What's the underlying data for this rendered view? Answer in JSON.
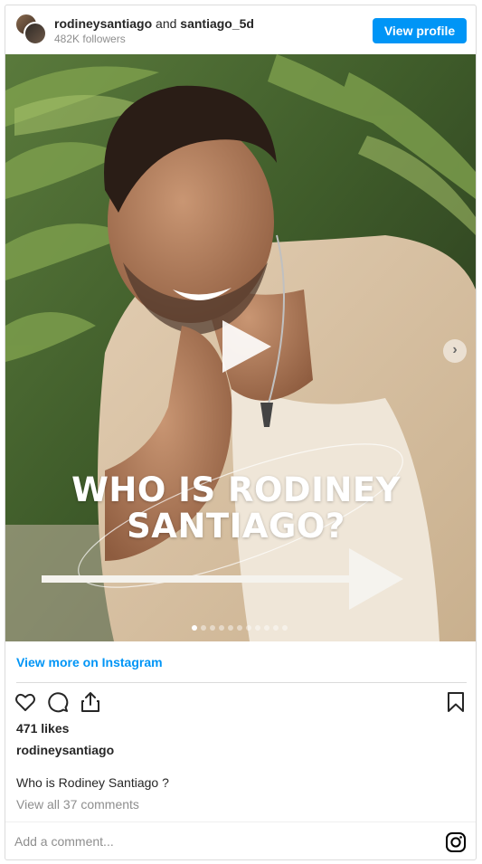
{
  "header": {
    "user1": "rodineysantiago",
    "conjunction": "and",
    "user2": "santiago_5d",
    "followers": "482K followers",
    "view_profile_label": "View profile"
  },
  "media": {
    "overlay_line1": "WHO IS RODINEY",
    "overlay_line2": "SANTIAGO?",
    "carousel_count": 11,
    "carousel_active_index": 0,
    "next_icon": "chevron-right-icon",
    "play_icon": "play-icon"
  },
  "footer": {
    "view_more_label": "View more on Instagram",
    "icons": [
      "heart-icon",
      "comment-icon",
      "share-icon",
      "bookmark-icon"
    ],
    "likes": "471 likes",
    "author": "rodineysantiago",
    "caption": "Who is Rodiney Santiago ?",
    "comments_link": "View all 37 comments",
    "comment_placeholder": "Add a comment...",
    "logo_icon": "instagram-icon"
  },
  "colors": {
    "accent": "#0095f6",
    "muted_text": "#8e8e8e",
    "border": "#dbdbdb"
  }
}
